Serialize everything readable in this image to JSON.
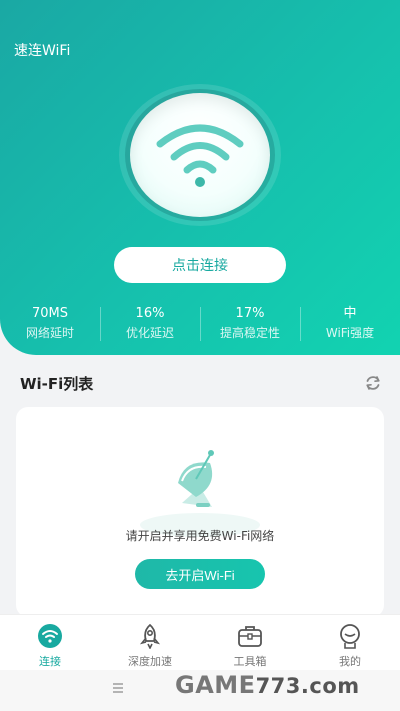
{
  "app": {
    "title": "速连WiFi"
  },
  "main": {
    "connect_label": "点击连接"
  },
  "stats": [
    {
      "value": "70MS",
      "label": "网络延时"
    },
    {
      "value": "16%",
      "label": "优化延迟"
    },
    {
      "value": "17%",
      "label": "提高稳定性"
    },
    {
      "value": "中",
      "label": "WiFi强度"
    }
  ],
  "wifi_list": {
    "title": "Wi-Fi列表",
    "empty_text": "请开启并享用免费Wi-Fi网络",
    "open_label": "去开启Wi-Fi"
  },
  "tabs": [
    {
      "label": "连接"
    },
    {
      "label": "深度加速"
    },
    {
      "label": "工具箱"
    },
    {
      "label": "我的"
    }
  ],
  "watermark": {
    "main": "GAME",
    "sub": "773.com"
  },
  "colors": {
    "accent": "#18a9a0",
    "header_start": "#1aa8a4",
    "header_end": "#12d3b1"
  },
  "icons": [
    "wifi-icon",
    "refresh-icon",
    "satellite-dish-icon",
    "rocket-icon",
    "toolbox-icon",
    "profile-icon",
    "menu-icon"
  ]
}
